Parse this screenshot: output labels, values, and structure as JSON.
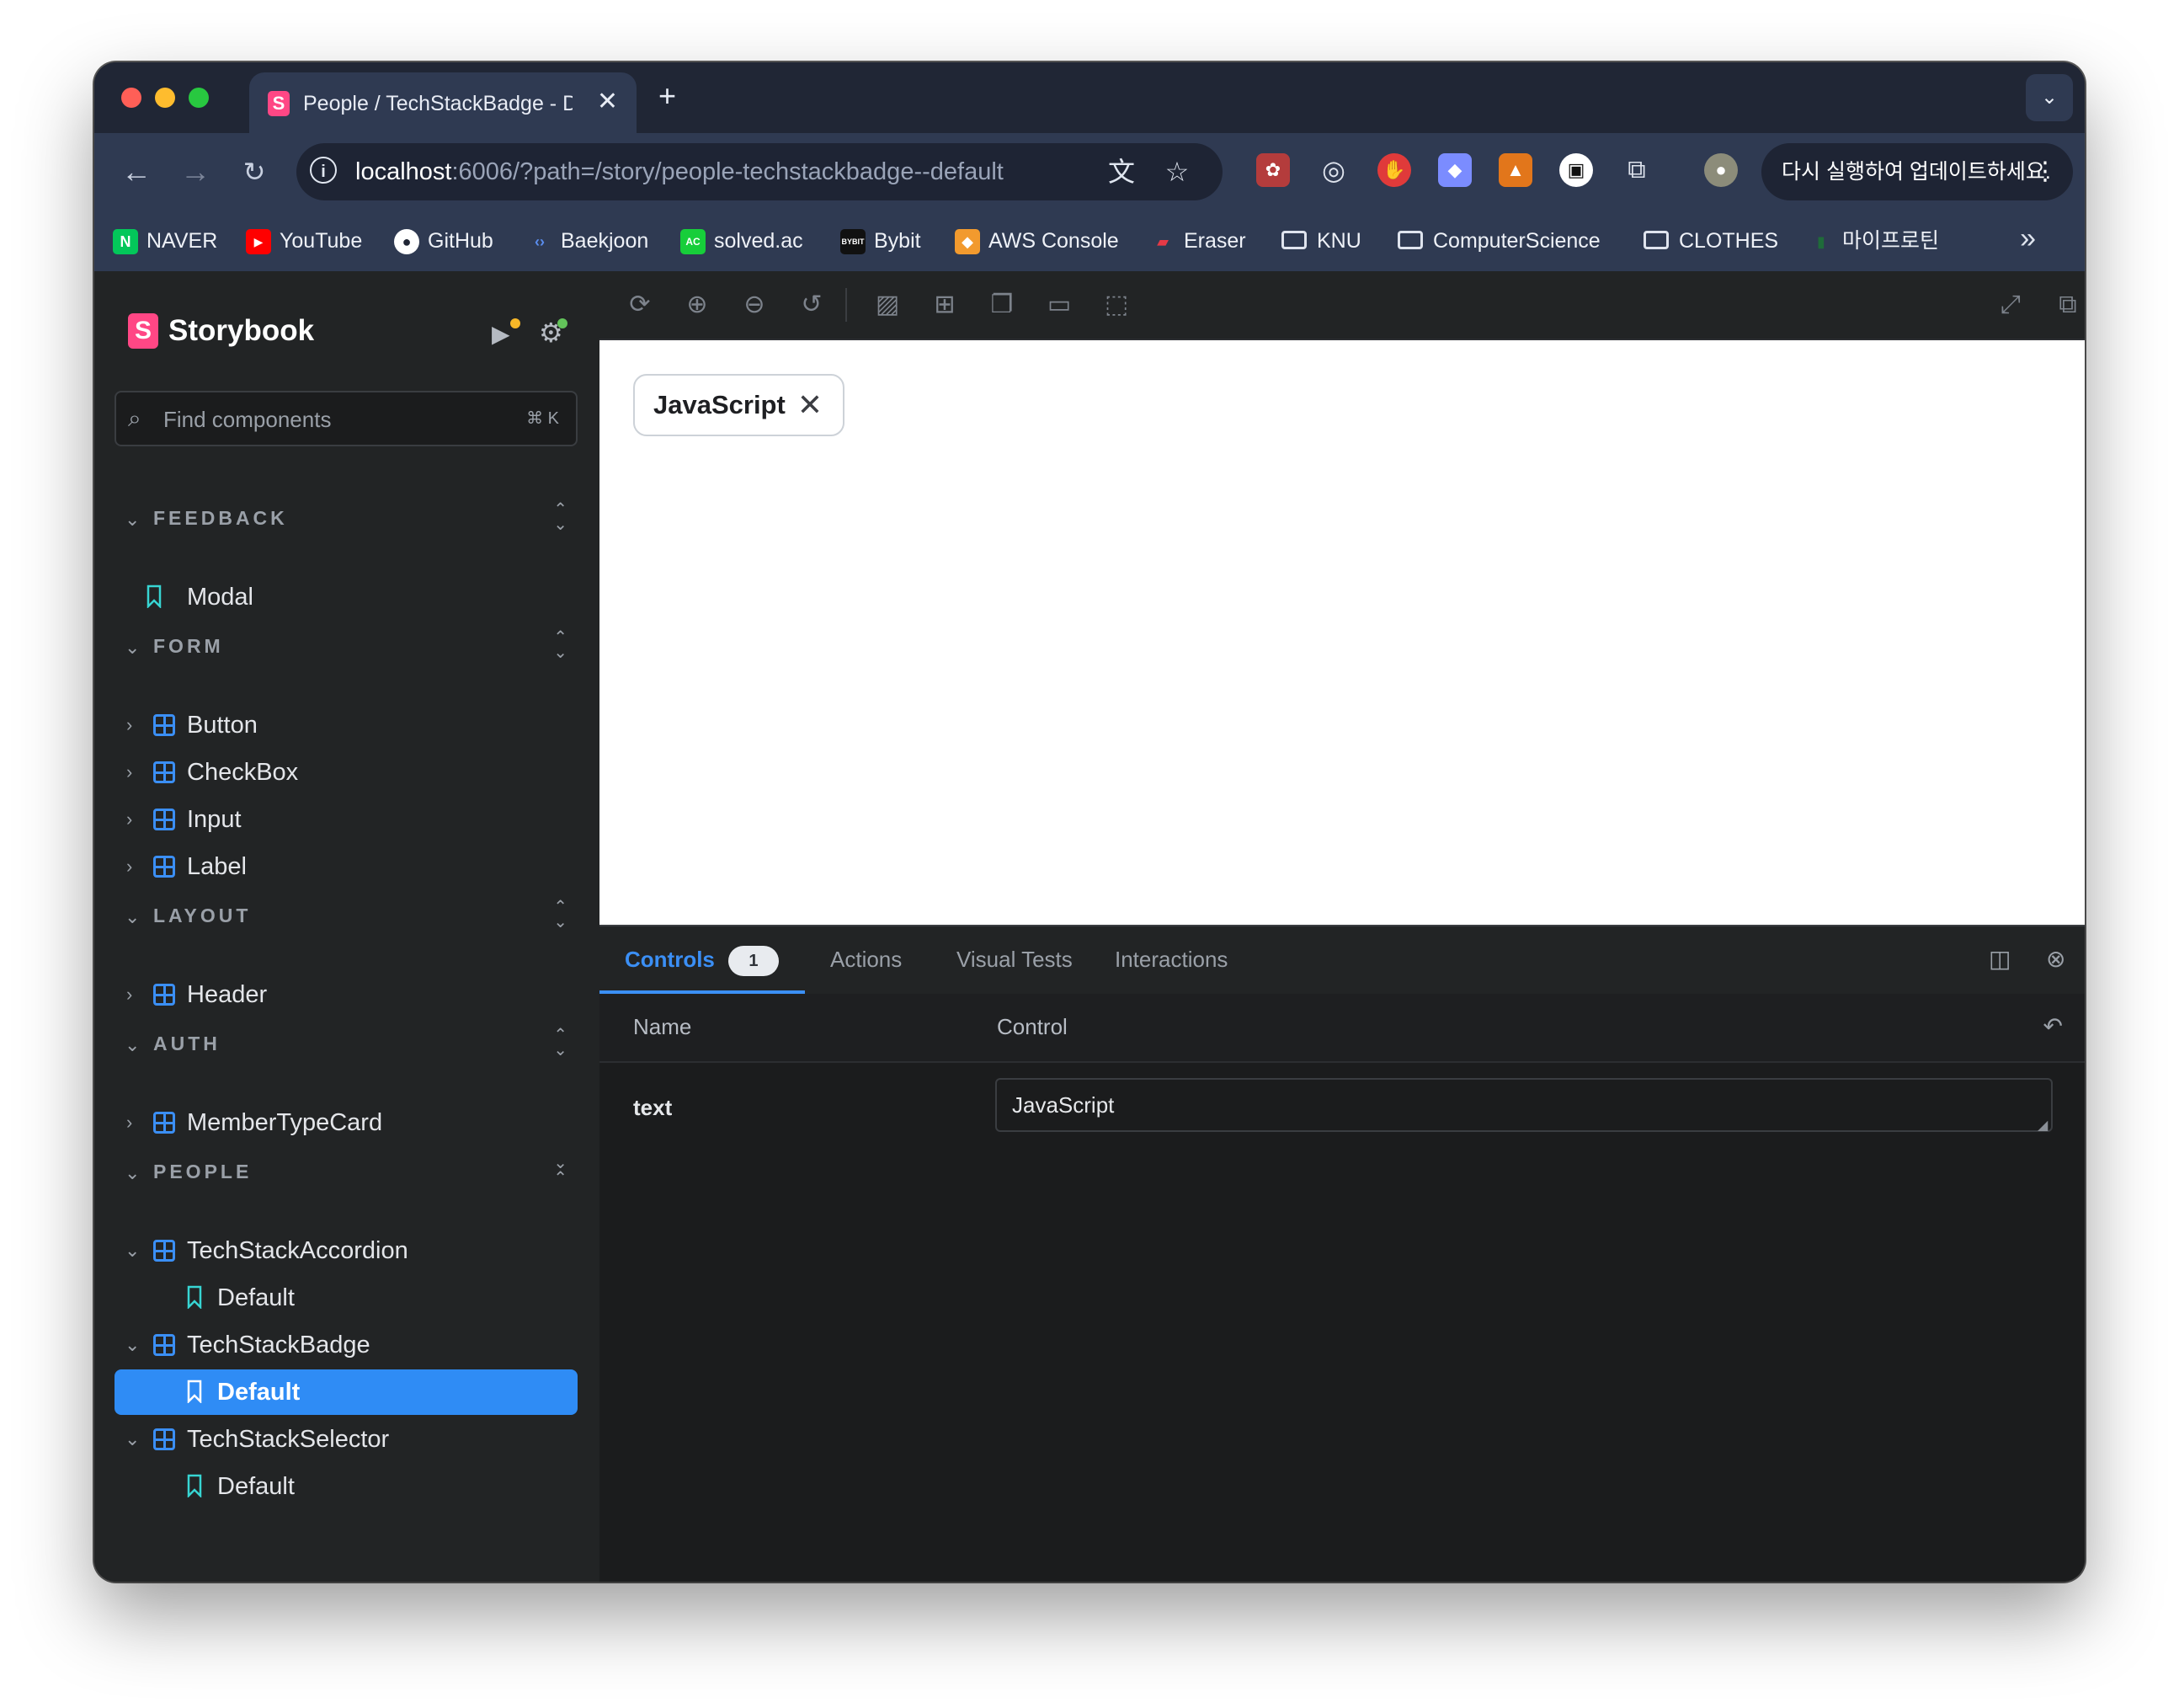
{
  "browser": {
    "tab": {
      "title": "People / TechStackBadge - D",
      "favicon": "S"
    },
    "url": {
      "host": "localhost",
      "path": ":6006/?path=/story/people-techstackbadge--default"
    },
    "update_pill": "다시 실행하여 업데이트하세요."
  },
  "bookmarks": [
    {
      "label": "NAVER",
      "icon": "naver-icon",
      "color": "#03c75a"
    },
    {
      "label": "YouTube",
      "icon": "youtube-icon",
      "color": "#ff0000"
    },
    {
      "label": "GitHub",
      "icon": "github-icon",
      "color": "#ffffff"
    },
    {
      "label": "Baekjoon",
      "icon": "baekjoon-icon",
      "color": "#5a8dee"
    },
    {
      "label": "solved.ac",
      "icon": "solvedac-icon",
      "color": "#17ce3a"
    },
    {
      "label": "Bybit",
      "icon": "bybit-icon",
      "color": "#1a1a1a"
    },
    {
      "label": "AWS Console",
      "icon": "aws-icon",
      "color": "#f29a2e"
    },
    {
      "label": "Eraser",
      "icon": "eraser-icon",
      "color": "#e63946"
    },
    {
      "label": "KNU",
      "icon": "folder-icon"
    },
    {
      "label": "ComputerScience",
      "icon": "folder-icon"
    },
    {
      "label": "CLOTHES",
      "icon": "folder-icon"
    },
    {
      "label": "마이프로틴",
      "icon": "myprotein-icon"
    }
  ],
  "sidebar": {
    "brand": "Storybook",
    "search_placeholder": "Find components",
    "search_shortcut": "⌘ K",
    "sections": [
      {
        "label": "FEEDBACK"
      },
      {
        "label": "FORM"
      },
      {
        "label": "LAYOUT"
      },
      {
        "label": "AUTH"
      },
      {
        "label": "PEOPLE"
      }
    ],
    "items": {
      "modal": "Modal",
      "button": "Button",
      "checkbox": "CheckBox",
      "input": "Input",
      "label": "Label",
      "header": "Header",
      "member_type_card": "MemberTypeCard",
      "tech_stack_accordion": "TechStackAccordion",
      "accordion_default": "Default",
      "tech_stack_badge": "TechStackBadge",
      "badge_default": "Default",
      "tech_stack_selector": "TechStackSelector",
      "selector_default": "Default"
    },
    "active_item": "badge_default",
    "accent": "#2f8cf5"
  },
  "preview": {
    "badge_text": "JavaScript"
  },
  "addons": {
    "tabs": [
      {
        "label": "Controls",
        "count": "1"
      },
      {
        "label": "Actions"
      },
      {
        "label": "Visual Tests"
      },
      {
        "label": "Interactions"
      }
    ],
    "controls": {
      "col_name": "Name",
      "col_control": "Control",
      "rows": [
        {
          "name": "text",
          "value": "JavaScript"
        }
      ]
    }
  }
}
